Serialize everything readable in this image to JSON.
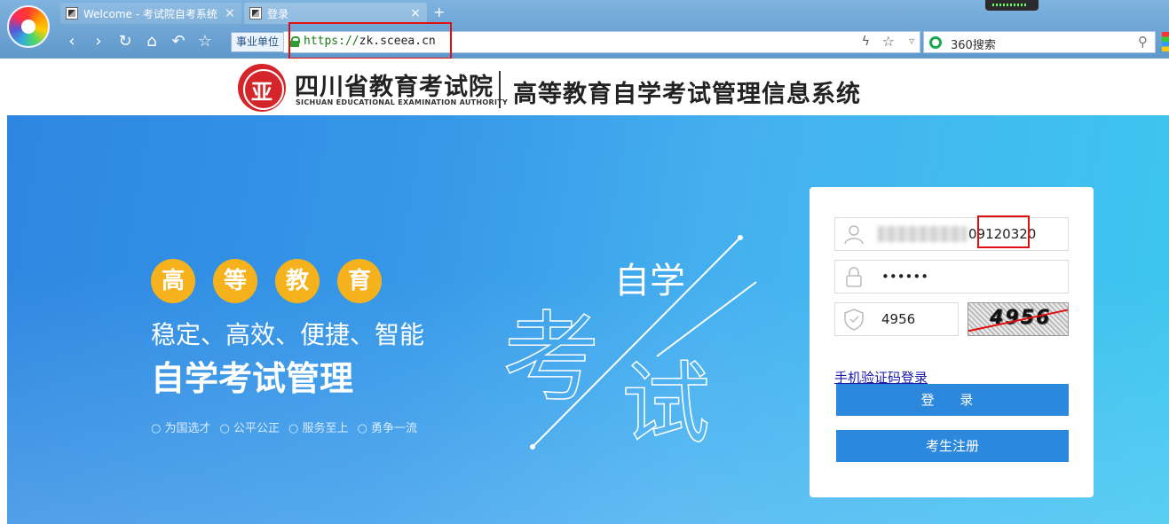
{
  "browser": {
    "tabs": [
      {
        "title": "Welcome - 考试院自考系统"
      },
      {
        "title": "登录"
      }
    ],
    "unit_label": "事业单位",
    "url_scheme": "https://",
    "url_host": "zk.sceea.cn",
    "search_placeholder": "360搜索"
  },
  "header": {
    "org_name": "四川省教育考试院",
    "org_name_en": "SICHUAN EDUCATIONAL EXAMINATION AUTHORITY",
    "system_title": "高等教育自学考试管理信息系统"
  },
  "banner": {
    "pills": [
      "高",
      "等",
      "教",
      "育"
    ],
    "slogan_line1": "稳定、高效、便捷、智能",
    "slogan_line2": "自学考试管理",
    "values": [
      "为国选才",
      "公平公正",
      "服务至上",
      "勇争一流"
    ],
    "art_text_small": "自学",
    "art_text_kao": "考",
    "art_text_shi": "试"
  },
  "login": {
    "username_visible_suffix": "09120320",
    "password_masked": "••••••",
    "captcha_input": "4956",
    "captcha_image_text": "4956",
    "sms_login_link": "手机验证码登录",
    "login_button": "登 录",
    "register_button": "考生注册"
  },
  "colors": {
    "primary_button": "#2b88dc",
    "pill": "#f6b21c",
    "highlight": "#e01010",
    "emblem": "#d4252a"
  }
}
